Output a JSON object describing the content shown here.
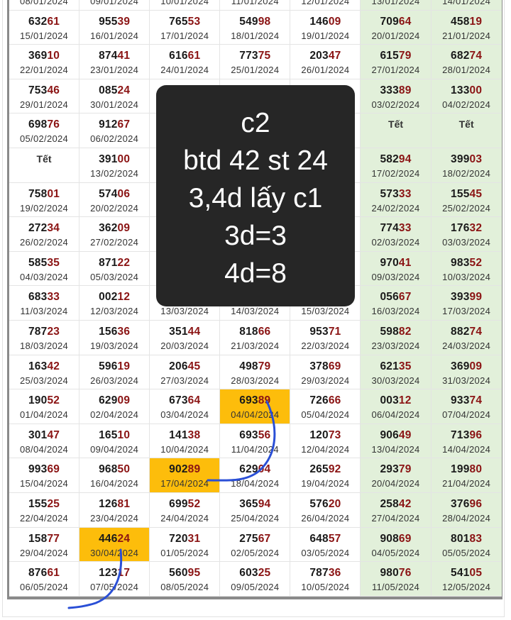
{
  "colors": {
    "accent_red": "#8b1414",
    "weekend_bg": "#e2f0da",
    "highlight_bg": "#fdbd0b",
    "ink": "#2a4fd6",
    "overlay_bg": "#262626"
  },
  "rows": [
    [
      {
        "date": "08/01/2024"
      },
      {
        "date": "09/01/2024"
      },
      {
        "date": "10/01/2024"
      },
      {
        "date": "11/01/2024"
      },
      {
        "date": "12/01/2024"
      },
      {
        "date": "13/01/2024"
      },
      {
        "date": "14/01/2024"
      }
    ],
    [
      {
        "num": "63261",
        "date": "15/01/2024"
      },
      {
        "num": "95539",
        "date": "16/01/2024"
      },
      {
        "num": "76553",
        "date": "17/01/2024"
      },
      {
        "num": "54998",
        "date": "18/01/2024"
      },
      {
        "num": "14609",
        "date": "19/01/2024"
      },
      {
        "num": "70964",
        "date": "20/01/2024"
      },
      {
        "num": "45819",
        "date": "21/01/2024"
      }
    ],
    [
      {
        "num": "36910",
        "date": "22/01/2024"
      },
      {
        "num": "87441",
        "date": "23/01/2024"
      },
      {
        "num": "61661",
        "date": "24/01/2024"
      },
      {
        "num": "77375",
        "date": "25/01/2024"
      },
      {
        "num": "20347",
        "date": "26/01/2024"
      },
      {
        "num": "61579",
        "date": "27/01/2024"
      },
      {
        "num": "68274",
        "date": "28/01/2024"
      }
    ],
    [
      {
        "num": "75346",
        "date": "29/01/2024"
      },
      {
        "num": "08524",
        "date": "30/01/2024"
      },
      {},
      {},
      {},
      {
        "num": "33389",
        "date": "03/02/2024"
      },
      {
        "num": "13300",
        "date": "04/02/2024"
      }
    ],
    [
      {
        "num": "69876",
        "date": "05/02/2024"
      },
      {
        "num": "91267",
        "date": "06/02/2024"
      },
      {},
      {},
      {},
      {
        "tet": "Tết"
      },
      {
        "tet": "Tết"
      }
    ],
    [
      {
        "tet": "Tết"
      },
      {
        "num": "39100",
        "date": "13/02/2024"
      },
      {},
      {},
      {},
      {
        "num": "58294",
        "date": "17/02/2024"
      },
      {
        "num": "39903",
        "date": "18/02/2024"
      }
    ],
    [
      {
        "num": "75801",
        "date": "19/02/2024"
      },
      {
        "num": "57406",
        "date": "20/02/2024"
      },
      {},
      {},
      {},
      {
        "num": "57333",
        "date": "24/02/2024"
      },
      {
        "num": "15545",
        "date": "25/02/2024"
      }
    ],
    [
      {
        "num": "27234",
        "date": "26/02/2024"
      },
      {
        "num": "36209",
        "date": "27/02/2024"
      },
      {},
      {},
      {},
      {
        "num": "77433",
        "date": "02/03/2024"
      },
      {
        "num": "17632",
        "date": "03/03/2024"
      }
    ],
    [
      {
        "num": "58535",
        "date": "04/03/2024"
      },
      {
        "num": "87122",
        "date": "05/03/2024"
      },
      {},
      {},
      {},
      {
        "num": "97041",
        "date": "09/03/2024"
      },
      {
        "num": "98352",
        "date": "10/03/2024"
      }
    ],
    [
      {
        "num": "68333",
        "date": "11/03/2024"
      },
      {
        "num": "00212",
        "date": "12/03/2024"
      },
      {
        "date": "13/03/2024"
      },
      {
        "date": "14/03/2024"
      },
      {
        "date": "15/03/2024"
      },
      {
        "num": "05667",
        "date": "16/03/2024"
      },
      {
        "num": "39399",
        "date": "17/03/2024"
      }
    ],
    [
      {
        "num": "78723",
        "date": "18/03/2024"
      },
      {
        "num": "15636",
        "date": "19/03/2024"
      },
      {
        "num": "35144",
        "date": "20/03/2024"
      },
      {
        "num": "81866",
        "date": "21/03/2024"
      },
      {
        "num": "95371",
        "date": "22/03/2024"
      },
      {
        "num": "59882",
        "date": "23/03/2024"
      },
      {
        "num": "88274",
        "date": "24/03/2024"
      }
    ],
    [
      {
        "num": "16342",
        "date": "25/03/2024"
      },
      {
        "num": "59619",
        "date": "26/03/2024"
      },
      {
        "num": "20645",
        "date": "27/03/2024"
      },
      {
        "num": "49879",
        "date": "28/03/2024"
      },
      {
        "num": "37869",
        "date": "29/03/2024"
      },
      {
        "num": "62135",
        "date": "30/03/2024"
      },
      {
        "num": "36909",
        "date": "31/03/2024"
      }
    ],
    [
      {
        "num": "19052",
        "date": "01/04/2024"
      },
      {
        "num": "62909",
        "date": "02/04/2024"
      },
      {
        "num": "67364",
        "date": "03/04/2024"
      },
      {
        "num": "69389",
        "date": "04/04/2024",
        "highlight": true
      },
      {
        "num": "72666",
        "date": "05/04/2024"
      },
      {
        "num": "00312",
        "date": "06/04/2024"
      },
      {
        "num": "93374",
        "date": "07/04/2024"
      }
    ],
    [
      {
        "num": "30147",
        "date": "08/04/2024"
      },
      {
        "num": "16510",
        "date": "09/04/2024"
      },
      {
        "num": "14138",
        "date": "10/04/2024"
      },
      {
        "num": "69356",
        "date": "11/04/2024"
      },
      {
        "num": "12073",
        "date": "12/04/2024"
      },
      {
        "num": "90649",
        "date": "13/04/2024"
      },
      {
        "num": "71396",
        "date": "14/04/2024"
      }
    ],
    [
      {
        "num": "99369",
        "date": "15/04/2024"
      },
      {
        "num": "96850",
        "date": "16/04/2024"
      },
      {
        "num": "90289",
        "date": "17/04/2024",
        "highlight": true
      },
      {
        "num": "62904",
        "date": "18/04/2024"
      },
      {
        "num": "26592",
        "date": "19/04/2024"
      },
      {
        "num": "29379",
        "date": "20/04/2024"
      },
      {
        "num": "19980",
        "date": "21/04/2024"
      }
    ],
    [
      {
        "num": "15525",
        "date": "22/04/2024"
      },
      {
        "num": "12681",
        "date": "23/04/2024"
      },
      {
        "num": "69952",
        "date": "24/04/2024"
      },
      {
        "num": "36594",
        "date": "25/04/2024"
      },
      {
        "num": "57620",
        "date": "26/04/2024"
      },
      {
        "num": "25842",
        "date": "27/04/2024"
      },
      {
        "num": "37696",
        "date": "28/04/2024"
      }
    ],
    [
      {
        "num": "15877",
        "date": "29/04/2024"
      },
      {
        "num": "44624",
        "date": "30/04/2024",
        "highlight": true
      },
      {
        "num": "72031",
        "date": "01/05/2024"
      },
      {
        "num": "27567",
        "date": "02/05/2024"
      },
      {
        "num": "64857",
        "date": "03/05/2024"
      },
      {
        "num": "90869",
        "date": "04/05/2024"
      },
      {
        "num": "80183",
        "date": "05/05/2024"
      }
    ],
    [
      {
        "num": "87661",
        "date": "06/05/2024"
      },
      {
        "num": "12317",
        "date": "07/05/2024"
      },
      {
        "num": "56095",
        "date": "08/05/2024"
      },
      {
        "num": "60325",
        "date": "09/05/2024"
      },
      {
        "num": "78736",
        "date": "10/05/2024"
      },
      {
        "num": "98076",
        "date": "11/05/2024"
      },
      {
        "num": "54105",
        "date": "12/05/2024"
      }
    ]
  ],
  "overlay": {
    "lines": [
      "c2",
      "btd 42 st 24",
      "3,4d lấy c1",
      "3d=3",
      "4d=8"
    ]
  }
}
